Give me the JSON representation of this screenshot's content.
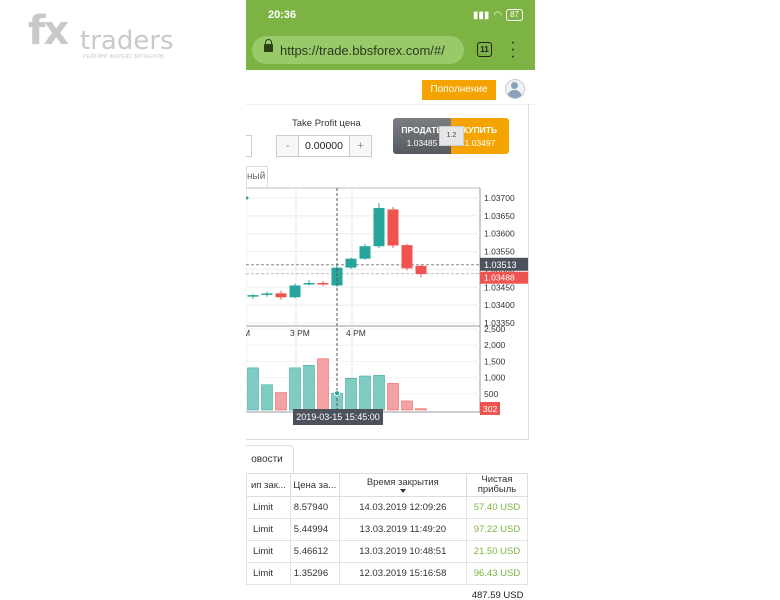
{
  "watermark": {
    "logo_fx": "fx",
    "logo_traders": "traders",
    "logo_subtitle": "РЕЙТИНГ ФОРЕКС БРОКЕРОВ"
  },
  "statusbar": {
    "time": "20:36",
    "battery": "87"
  },
  "browser": {
    "url": "https://trade.bbsforex.com/#/",
    "tab_count": "11"
  },
  "header": {
    "deposit_label": "Пополнение"
  },
  "trade_panel": {
    "take_profit_label": "Take Profit цена",
    "take_profit_value": "0.00000",
    "minus": "-",
    "plus": "+",
    "sell_label": "ПРОДАТЬ",
    "sell_price": "1.03485",
    "buy_label": "КУПИТЬ",
    "buy_price": "1.03497",
    "spread": "1.2",
    "chart_tab_label": "ный"
  },
  "chart_data": {
    "type": "candlestick",
    "price_ticks": [
      "1.03700",
      "1.03650",
      "1.03600",
      "1.03550",
      "1.03500",
      "1.03450",
      "1.03400",
      "1.03350"
    ],
    "volume_ticks": [
      "2,500",
      "2,000",
      "1,500",
      "1,000",
      "500"
    ],
    "time_labels": [
      "M",
      "3 PM",
      "4 PM"
    ],
    "current_price": "1.03513",
    "bid_price_tag": "1.03488",
    "volume_tag": "302",
    "crosshair_time": "2019-03-15 15:45:00",
    "candles": [
      {
        "open": 1.03425,
        "close": 1.03428,
        "high": 1.03432,
        "low": 1.03418,
        "volume": 1300,
        "dir": "up"
      },
      {
        "open": 1.0343,
        "close": 1.03433,
        "high": 1.03437,
        "low": 1.03424,
        "volume": 780,
        "dir": "up"
      },
      {
        "open": 1.03433,
        "close": 1.03422,
        "high": 1.0344,
        "low": 1.03415,
        "volume": 540,
        "dir": "down"
      },
      {
        "open": 1.03422,
        "close": 1.03455,
        "high": 1.0346,
        "low": 1.0342,
        "volume": 1300,
        "dir": "up"
      },
      {
        "open": 1.03458,
        "close": 1.03462,
        "high": 1.0347,
        "low": 1.03455,
        "volume": 1380,
        "dir": "up"
      },
      {
        "open": 1.03462,
        "close": 1.03458,
        "high": 1.03468,
        "low": 1.03454,
        "volume": 1580,
        "dir": "down"
      },
      {
        "open": 1.03455,
        "close": 1.03505,
        "high": 1.0351,
        "low": 1.03452,
        "volume": 520,
        "dir": "up"
      },
      {
        "open": 1.03505,
        "close": 1.0353,
        "high": 1.03533,
        "low": 1.03502,
        "volume": 980,
        "dir": "up"
      },
      {
        "open": 1.0353,
        "close": 1.03565,
        "high": 1.03572,
        "low": 1.03527,
        "volume": 1050,
        "dir": "up"
      },
      {
        "open": 1.03565,
        "close": 1.03672,
        "high": 1.03685,
        "low": 1.0356,
        "volume": 1070,
        "dir": "up"
      },
      {
        "open": 1.03668,
        "close": 1.03567,
        "high": 1.03675,
        "low": 1.0356,
        "volume": 820,
        "dir": "down"
      },
      {
        "open": 1.03568,
        "close": 1.03503,
        "high": 1.03572,
        "low": 1.03497,
        "volume": 280,
        "dir": "down"
      },
      {
        "open": 1.0351,
        "close": 1.03487,
        "high": 1.03513,
        "low": 1.03478,
        "volume": 40,
        "dir": "down"
      }
    ],
    "colors": {
      "up": "#26a69a",
      "down": "#ef5350",
      "up_volume": "#80cbc4",
      "down_volume": "#f4a3a3"
    }
  },
  "news_tab": "овости",
  "table": {
    "headers": {
      "type": "ип зак...",
      "price": "Цена за...",
      "close_time": "Время закрытия",
      "profit": "Чистая прибыль"
    },
    "rows": [
      {
        "type": "Limit",
        "price": "8.57940",
        "time": "14.03.2019 12:09:26",
        "profit": "57.40 USD"
      },
      {
        "type": "Limit",
        "price": "5.44994",
        "time": "13.03.2019 11:49:20",
        "profit": "97.22 USD"
      },
      {
        "type": "Limit",
        "price": "5.46612",
        "time": "13.03.2019 10:48:51",
        "profit": "21.50 USD"
      },
      {
        "type": "Limit",
        "price": "1.35296",
        "time": "12.03.2019 15:16:58",
        "profit": "96.43 USD"
      }
    ],
    "total": "487.59 USD"
  }
}
